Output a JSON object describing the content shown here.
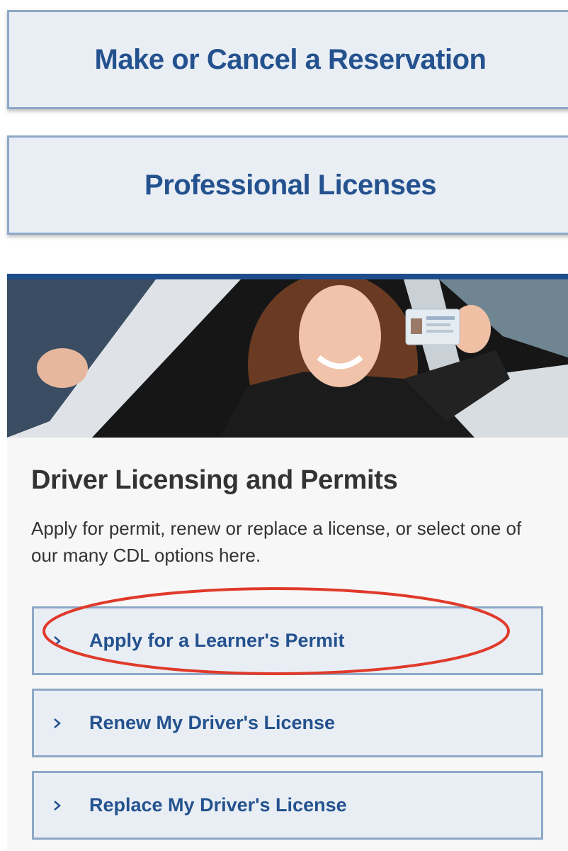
{
  "top_buttons": {
    "reservation": "Make or Cancel a Reservation",
    "professional": "Professional Licenses"
  },
  "card": {
    "title": "Driver Licensing and Permits",
    "description": "Apply for permit, renew or replace a license, or select one of our many CDL options here.",
    "links": [
      {
        "label": "Apply for a Learner's Permit",
        "icon": "chevron-right-icon"
      },
      {
        "label": "Renew My Driver's License",
        "icon": "chevron-right-icon"
      },
      {
        "label": "Replace My Driver's License",
        "icon": "chevron-right-icon"
      }
    ]
  },
  "colors": {
    "accent": "#24528e",
    "button_bg": "#e9eef5",
    "button_border": "#8ea8c7",
    "card_bar": "#1e4d8c",
    "annotation": "#e03a2a"
  }
}
